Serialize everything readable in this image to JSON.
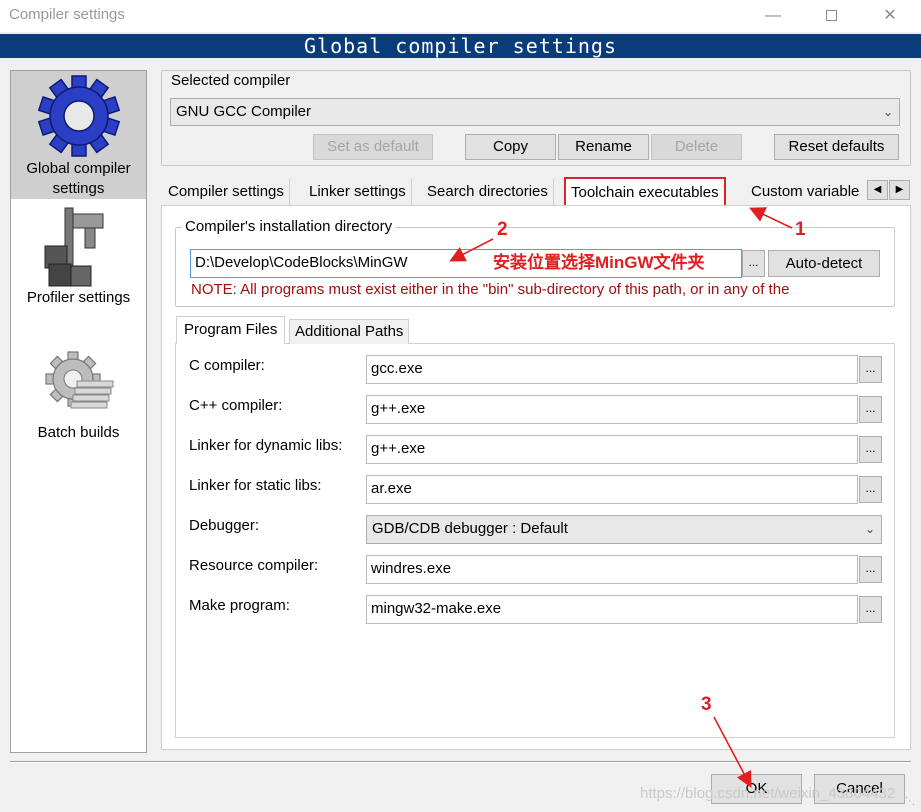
{
  "window": {
    "title": "Compiler settings",
    "header": "Global compiler settings"
  },
  "sidebar": {
    "items": [
      {
        "label": "Global compiler settings",
        "icon": "gear-icon",
        "selected": true
      },
      {
        "label": "Profiler settings",
        "icon": "caliper-icon",
        "selected": false
      },
      {
        "label": "Batch builds",
        "icon": "batch-gear-icon",
        "selected": false
      }
    ]
  },
  "compiler": {
    "section_label": "Selected compiler",
    "selected": "GNU GCC Compiler",
    "buttons": {
      "set_default": "Set as default",
      "copy": "Copy",
      "rename": "Rename",
      "delete": "Delete",
      "reset": "Reset defaults"
    }
  },
  "tabs": [
    "Compiler settings",
    "Linker settings",
    "Search directories",
    "Toolchain executables",
    "Custom variable"
  ],
  "install": {
    "group_label": "Compiler's installation directory",
    "path": "D:\\Develop\\CodeBlocks\\MinGW",
    "browse": "...",
    "autodetect": "Auto-detect",
    "note": "NOTE: All programs must exist either in the \"bin\" sub-directory of this path, or in any of the"
  },
  "subtabs": [
    "Program Files",
    "Additional Paths"
  ],
  "programs": [
    {
      "label": "C compiler:",
      "value": "gcc.exe"
    },
    {
      "label": "C++ compiler:",
      "value": "g++.exe"
    },
    {
      "label": "Linker for dynamic libs:",
      "value": "g++.exe"
    },
    {
      "label": "Linker for static libs:",
      "value": "ar.exe"
    },
    {
      "label": "Debugger:",
      "value": "GDB/CDB debugger : Default"
    },
    {
      "label": "Resource compiler:",
      "value": "windres.exe"
    },
    {
      "label": "Make program:",
      "value": "mingw32-make.exe"
    }
  ],
  "annotations": {
    "one": "1",
    "two": "2",
    "three": "3",
    "chinese_note": "安装位置选择MinGW文件夹"
  },
  "footer": {
    "ok": "OK",
    "cancel": "Cancel",
    "watermark": "https://blog.csdn.net/weixin_43804432"
  },
  "colors": {
    "header_bg": "#0a3b7a",
    "annotation": "#e02020",
    "note_text": "#a01010"
  }
}
